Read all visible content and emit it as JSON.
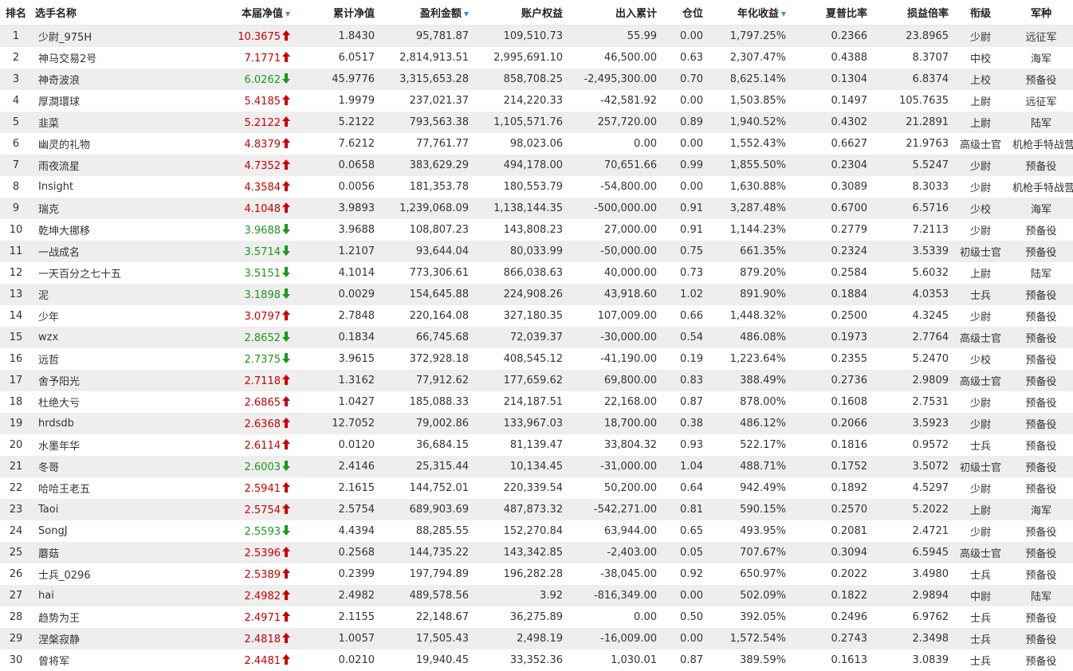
{
  "colors": {
    "up": "#cc0000",
    "down": "#1a9a1a",
    "sort": "#3b8fd6",
    "stripe": "#eeeeee"
  },
  "headers": {
    "rank": "排名",
    "name": "选手名称",
    "nav": "本届净值",
    "cum_nav": "累计净值",
    "profit": "盈利金额",
    "equity": "账户权益",
    "flow": "出入累计",
    "position": "仓位",
    "annual": "年化收益",
    "sharpe": "夏普比率",
    "pl_ratio": "损益倍率",
    "rank_title": "衔级",
    "branch": "军种"
  },
  "sort_icon": "triangle-down-icon",
  "rows": [
    {
      "rank": "1",
      "name": "少尉_975H",
      "nav": "10.3675",
      "dir": "up",
      "cum_nav": "1.8430",
      "profit": "95,781.87",
      "equity": "109,510.73",
      "flow": "55.99",
      "position": "0.00",
      "annual": "1,797.25%",
      "sharpe": "0.2366",
      "pl_ratio": "23.8965",
      "rank_title": "少尉",
      "branch": "远征军"
    },
    {
      "rank": "2",
      "name": "神马交易2号",
      "nav": "7.1771",
      "dir": "up",
      "cum_nav": "6.0517",
      "profit": "2,814,913.51",
      "equity": "2,995,691.10",
      "flow": "46,500.00",
      "position": "0.63",
      "annual": "2,307.47%",
      "sharpe": "0.4388",
      "pl_ratio": "8.3707",
      "rank_title": "中校",
      "branch": "海军"
    },
    {
      "rank": "3",
      "name": "神奇波浪",
      "nav": "6.0262",
      "dir": "down",
      "cum_nav": "45.9776",
      "profit": "3,315,653.28",
      "equity": "858,708.25",
      "flow": "-2,495,300.00",
      "position": "0.70",
      "annual": "8,625.14%",
      "sharpe": "0.1304",
      "pl_ratio": "6.8374",
      "rank_title": "上校",
      "branch": "预备役"
    },
    {
      "rank": "4",
      "name": "厚澗環球",
      "nav": "5.4185",
      "dir": "up",
      "cum_nav": "1.9979",
      "profit": "237,021.37",
      "equity": "214,220.33",
      "flow": "-42,581.92",
      "position": "0.00",
      "annual": "1,503.85%",
      "sharpe": "0.1497",
      "pl_ratio": "105.7635",
      "rank_title": "上尉",
      "branch": "远征军"
    },
    {
      "rank": "5",
      "name": "韭菜",
      "nav": "5.2122",
      "dir": "up",
      "cum_nav": "5.2122",
      "profit": "793,563.38",
      "equity": "1,105,571.76",
      "flow": "257,720.00",
      "position": "0.89",
      "annual": "1,940.52%",
      "sharpe": "0.4302",
      "pl_ratio": "21.2891",
      "rank_title": "上尉",
      "branch": "陆军"
    },
    {
      "rank": "6",
      "name": "幽灵的礼物",
      "nav": "4.8379",
      "dir": "up",
      "cum_nav": "7.6212",
      "profit": "77,761.77",
      "equity": "98,023.06",
      "flow": "0.00",
      "position": "0.00",
      "annual": "1,552.43%",
      "sharpe": "0.6627",
      "pl_ratio": "21.9763",
      "rank_title": "高级士官",
      "branch": "机枪手特战营"
    },
    {
      "rank": "7",
      "name": "雨夜流星",
      "nav": "4.7352",
      "dir": "up",
      "cum_nav": "0.0658",
      "profit": "383,629.29",
      "equity": "494,178.00",
      "flow": "70,651.66",
      "position": "0.99",
      "annual": "1,855.50%",
      "sharpe": "0.2304",
      "pl_ratio": "5.5247",
      "rank_title": "少尉",
      "branch": "预备役"
    },
    {
      "rank": "8",
      "name": "Insight",
      "nav": "4.3584",
      "dir": "up",
      "cum_nav": "0.0056",
      "profit": "181,353.78",
      "equity": "180,553.79",
      "flow": "-54,800.00",
      "position": "0.00",
      "annual": "1,630.88%",
      "sharpe": "0.3089",
      "pl_ratio": "8.3033",
      "rank_title": "少尉",
      "branch": "机枪手特战营"
    },
    {
      "rank": "9",
      "name": "瑞克",
      "nav": "4.1048",
      "dir": "up",
      "cum_nav": "3.9893",
      "profit": "1,239,068.09",
      "equity": "1,138,144.35",
      "flow": "-500,000.00",
      "position": "0.91",
      "annual": "3,287.48%",
      "sharpe": "0.6700",
      "pl_ratio": "6.5716",
      "rank_title": "少校",
      "branch": "海军"
    },
    {
      "rank": "10",
      "name": "乾坤大挪移",
      "nav": "3.9688",
      "dir": "down",
      "cum_nav": "3.9688",
      "profit": "108,807.23",
      "equity": "143,808.23",
      "flow": "27,000.00",
      "position": "0.91",
      "annual": "1,144.23%",
      "sharpe": "0.2779",
      "pl_ratio": "7.2113",
      "rank_title": "少尉",
      "branch": "预备役"
    },
    {
      "rank": "11",
      "name": "一战成名",
      "nav": "3.5714",
      "dir": "down",
      "cum_nav": "1.2107",
      "profit": "93,644.04",
      "equity": "80,033.99",
      "flow": "-50,000.00",
      "position": "0.75",
      "annual": "661.35%",
      "sharpe": "0.2324",
      "pl_ratio": "3.5339",
      "rank_title": "初级士官",
      "branch": "预备役"
    },
    {
      "rank": "12",
      "name": "一天百分之七十五",
      "nav": "3.5151",
      "dir": "down",
      "cum_nav": "4.1014",
      "profit": "773,306.61",
      "equity": "866,038.63",
      "flow": "40,000.00",
      "position": "0.73",
      "annual": "879.20%",
      "sharpe": "0.2584",
      "pl_ratio": "5.6032",
      "rank_title": "上尉",
      "branch": "陆军"
    },
    {
      "rank": "13",
      "name": "泥",
      "nav": "3.1898",
      "dir": "down",
      "cum_nav": "0.0029",
      "profit": "154,645.88",
      "equity": "224,908.26",
      "flow": "43,918.60",
      "position": "1.02",
      "annual": "891.90%",
      "sharpe": "0.1884",
      "pl_ratio": "4.0353",
      "rank_title": "士兵",
      "branch": "预备役"
    },
    {
      "rank": "14",
      "name": "少年",
      "nav": "3.0797",
      "dir": "up",
      "cum_nav": "2.7848",
      "profit": "220,164.08",
      "equity": "327,180.35",
      "flow": "107,009.00",
      "position": "0.66",
      "annual": "1,448.32%",
      "sharpe": "0.2500",
      "pl_ratio": "4.3245",
      "rank_title": "少尉",
      "branch": "预备役"
    },
    {
      "rank": "15",
      "name": "wzx",
      "nav": "2.8652",
      "dir": "down",
      "cum_nav": "0.1834",
      "profit": "66,745.68",
      "equity": "72,039.37",
      "flow": "-30,000.00",
      "position": "0.54",
      "annual": "486.08%",
      "sharpe": "0.1973",
      "pl_ratio": "2.7764",
      "rank_title": "高级士官",
      "branch": "预备役"
    },
    {
      "rank": "16",
      "name": "远哲",
      "nav": "2.7375",
      "dir": "down",
      "cum_nav": "3.9615",
      "profit": "372,928.18",
      "equity": "408,545.12",
      "flow": "-41,190.00",
      "position": "0.19",
      "annual": "1,223.64%",
      "sharpe": "0.2355",
      "pl_ratio": "5.2470",
      "rank_title": "少校",
      "branch": "预备役"
    },
    {
      "rank": "17",
      "name": "舍予阳光",
      "nav": "2.7118",
      "dir": "up",
      "cum_nav": "1.3162",
      "profit": "77,912.62",
      "equity": "177,659.62",
      "flow": "69,800.00",
      "position": "0.83",
      "annual": "388.49%",
      "sharpe": "0.2736",
      "pl_ratio": "2.9809",
      "rank_title": "高级士官",
      "branch": "预备役"
    },
    {
      "rank": "18",
      "name": "杜绝大亏",
      "nav": "2.6865",
      "dir": "up",
      "cum_nav": "1.0427",
      "profit": "185,088.33",
      "equity": "214,187.51",
      "flow": "22,168.00",
      "position": "0.87",
      "annual": "878.00%",
      "sharpe": "0.1608",
      "pl_ratio": "2.7531",
      "rank_title": "少尉",
      "branch": "预备役"
    },
    {
      "rank": "19",
      "name": "hrdsdb",
      "nav": "2.6368",
      "dir": "up",
      "cum_nav": "12.7052",
      "profit": "79,002.86",
      "equity": "133,967.03",
      "flow": "18,700.00",
      "position": "0.38",
      "annual": "486.12%",
      "sharpe": "0.2066",
      "pl_ratio": "3.5923",
      "rank_title": "少尉",
      "branch": "预备役"
    },
    {
      "rank": "20",
      "name": "水墨年华",
      "nav": "2.6114",
      "dir": "up",
      "cum_nav": "0.0120",
      "profit": "36,684.15",
      "equity": "81,139.47",
      "flow": "33,804.32",
      "position": "0.93",
      "annual": "522.17%",
      "sharpe": "0.1816",
      "pl_ratio": "0.9572",
      "rank_title": "士兵",
      "branch": "预备役"
    },
    {
      "rank": "21",
      "name": "冬哥",
      "nav": "2.6003",
      "dir": "down",
      "cum_nav": "2.4146",
      "profit": "25,315.44",
      "equity": "10,134.45",
      "flow": "-31,000.00",
      "position": "1.04",
      "annual": "488.71%",
      "sharpe": "0.1752",
      "pl_ratio": "3.5072",
      "rank_title": "初级士官",
      "branch": "预备役"
    },
    {
      "rank": "22",
      "name": "哈哈王老五",
      "nav": "2.5941",
      "dir": "up",
      "cum_nav": "2.1615",
      "profit": "144,752.01",
      "equity": "220,339.54",
      "flow": "50,200.00",
      "position": "0.64",
      "annual": "942.49%",
      "sharpe": "0.1892",
      "pl_ratio": "4.5297",
      "rank_title": "少尉",
      "branch": "预备役"
    },
    {
      "rank": "23",
      "name": "Taoi",
      "nav": "2.5754",
      "dir": "up",
      "cum_nav": "2.5754",
      "profit": "689,903.69",
      "equity": "487,873.32",
      "flow": "-542,271.00",
      "position": "0.81",
      "annual": "590.15%",
      "sharpe": "0.2570",
      "pl_ratio": "5.2022",
      "rank_title": "上尉",
      "branch": "海军"
    },
    {
      "rank": "24",
      "name": "SongJ",
      "nav": "2.5593",
      "dir": "down",
      "cum_nav": "4.4394",
      "profit": "88,285.55",
      "equity": "152,270.84",
      "flow": "63,944.00",
      "position": "0.65",
      "annual": "493.95%",
      "sharpe": "0.2081",
      "pl_ratio": "2.4721",
      "rank_title": "少尉",
      "branch": "预备役"
    },
    {
      "rank": "25",
      "name": "蘑菇",
      "nav": "2.5396",
      "dir": "up",
      "cum_nav": "0.2568",
      "profit": "144,735.22",
      "equity": "143,342.85",
      "flow": "-2,403.00",
      "position": "0.05",
      "annual": "707.67%",
      "sharpe": "0.3094",
      "pl_ratio": "6.5945",
      "rank_title": "高级士官",
      "branch": "预备役"
    },
    {
      "rank": "26",
      "name": "士兵_0296",
      "nav": "2.5389",
      "dir": "up",
      "cum_nav": "0.2399",
      "profit": "197,794.89",
      "equity": "196,282.28",
      "flow": "-38,045.00",
      "position": "0.92",
      "annual": "650.97%",
      "sharpe": "0.2022",
      "pl_ratio": "3.4980",
      "rank_title": "士兵",
      "branch": "预备役"
    },
    {
      "rank": "27",
      "name": "hai",
      "nav": "2.4982",
      "dir": "up",
      "cum_nav": "2.4982",
      "profit": "489,578.56",
      "equity": "3.92",
      "flow": "-816,349.00",
      "position": "0.00",
      "annual": "502.09%",
      "sharpe": "0.1822",
      "pl_ratio": "2.9894",
      "rank_title": "中尉",
      "branch": "陆军"
    },
    {
      "rank": "28",
      "name": "趋势为王",
      "nav": "2.4971",
      "dir": "up",
      "cum_nav": "2.1155",
      "profit": "22,148.67",
      "equity": "36,275.89",
      "flow": "0.00",
      "position": "0.50",
      "annual": "392.05%",
      "sharpe": "0.2496",
      "pl_ratio": "6.9762",
      "rank_title": "士兵",
      "branch": "预备役"
    },
    {
      "rank": "29",
      "name": "涅槃寂静",
      "nav": "2.4818",
      "dir": "up",
      "cum_nav": "1.0057",
      "profit": "17,505.43",
      "equity": "2,498.19",
      "flow": "-16,009.00",
      "position": "0.00",
      "annual": "1,572.54%",
      "sharpe": "0.2743",
      "pl_ratio": "2.3498",
      "rank_title": "士兵",
      "branch": "预备役"
    },
    {
      "rank": "30",
      "name": "曾将军",
      "nav": "2.4481",
      "dir": "up",
      "cum_nav": "0.0210",
      "profit": "19,940.45",
      "equity": "33,352.36",
      "flow": "1,030.01",
      "position": "0.87",
      "annual": "389.59%",
      "sharpe": "0.1613",
      "pl_ratio": "3.0839",
      "rank_title": "士兵",
      "branch": "预备役"
    }
  ]
}
